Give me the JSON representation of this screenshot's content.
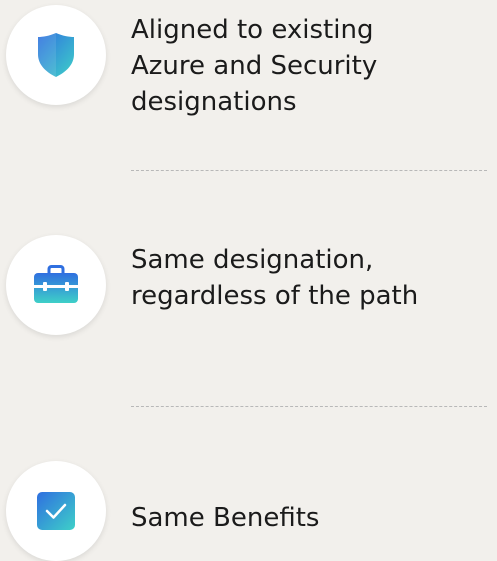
{
  "features": [
    {
      "icon": "shield-icon",
      "lines": [
        "Aligned to existing",
        "Azure and Security",
        "designations"
      ]
    },
    {
      "icon": "briefcase-icon",
      "lines": [
        "Same designation,",
        "regardless of the path"
      ]
    },
    {
      "icon": "checkbox-icon",
      "lines": [
        "Same Benefits"
      ]
    }
  ],
  "colors": {
    "background": "#f2f0ec",
    "icon_gradient_start": "#2f6fe0",
    "icon_gradient_end": "#3ed0c8",
    "text": "#1b1b1b",
    "divider": "#b8b8b8"
  }
}
